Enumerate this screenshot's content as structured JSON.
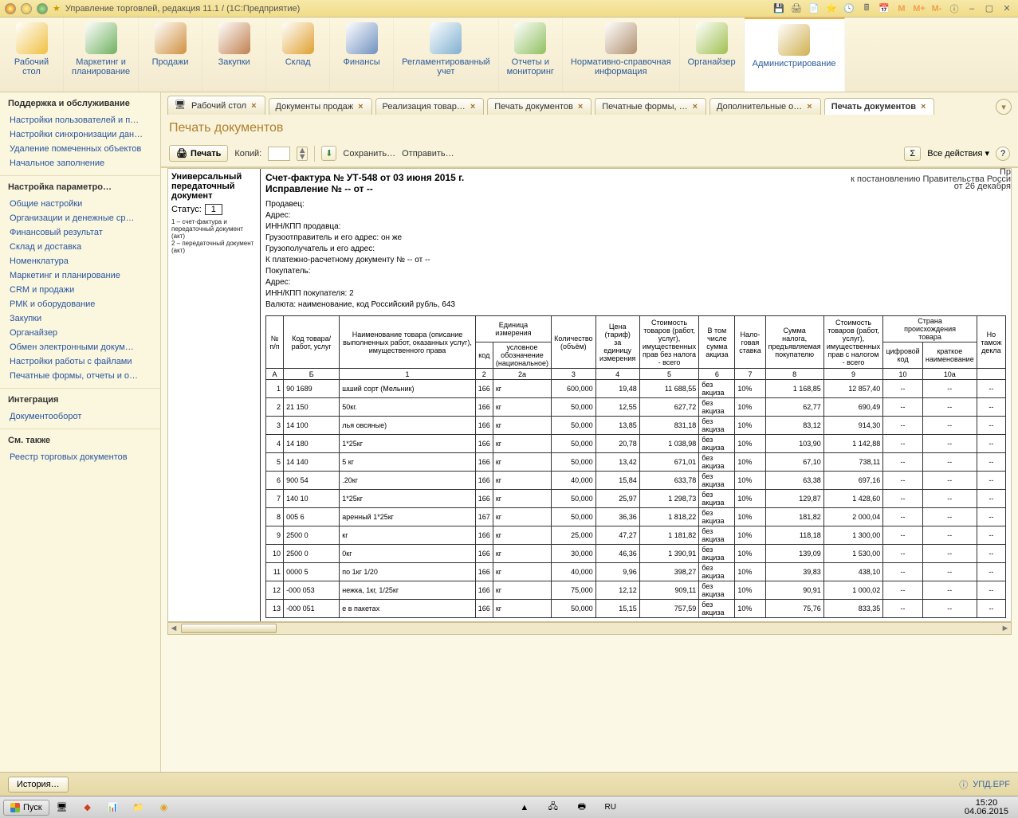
{
  "title_bar": {
    "app_title": "Управление торговлей, редакция 11.1 /          (1С:Предприятие)"
  },
  "ribbon": [
    {
      "label": "Рабочий\nстол",
      "color": "#f0c040"
    },
    {
      "label": "Маркетинг и\nпланирование",
      "color": "#70b060"
    },
    {
      "label": "Продажи",
      "color": "#d09040"
    },
    {
      "label": "Закупки",
      "color": "#c08050"
    },
    {
      "label": "Склад",
      "color": "#e0a030"
    },
    {
      "label": "Финансы",
      "color": "#7090c0"
    },
    {
      "label": "Регламентированный\nучет",
      "color": "#80b0d0"
    },
    {
      "label": "Отчеты и\nмониторинг",
      "color": "#90c060"
    },
    {
      "label": "Нормативно-справочная\nинформация",
      "color": "#b09070"
    },
    {
      "label": "Органайзер",
      "color": "#a0c050"
    },
    {
      "label": "Администрирование",
      "color": "#d0b050",
      "active": true
    }
  ],
  "nav": {
    "sections": [
      {
        "head": "Поддержка и обслуживание",
        "links": [
          "Настройки пользователей и п…",
          "Настройки синхронизации дан…",
          "Удаление помеченных объектов"
        ]
      },
      {
        "head": "",
        "links": [
          "Начальное заполнение"
        ]
      },
      {
        "head": "Настройка параметро…",
        "links": [
          "Общие настройки",
          "Организации и денежные ср…",
          "Финансовый результат",
          "Склад и доставка",
          "Номенклатура",
          "Маркетинг и планирование",
          "CRM и продажи",
          "РМК и оборудование",
          "Закупки",
          "Органайзер",
          "Обмен электронными докум…",
          "Настройки работы с файлами",
          "Печатные формы, отчеты и о…"
        ]
      },
      {
        "head": "Интеграция",
        "links": [
          "Документооборот"
        ]
      },
      {
        "head": "См. также",
        "links": [
          "Реестр торговых документов"
        ]
      }
    ]
  },
  "tabs": [
    {
      "label": "Рабочий стол",
      "icon": true
    },
    {
      "label": "Документы продаж"
    },
    {
      "label": "Реализация товар…"
    },
    {
      "label": "Печать документов"
    },
    {
      "label": "Печатные формы, …"
    },
    {
      "label": "Дополнительные о…"
    },
    {
      "label": "Печать документов",
      "active": true
    }
  ],
  "page_title": "Печать документов",
  "toolbar": {
    "print": "Печать",
    "copies_label": "Копий:",
    "copies_value": "",
    "save": "Сохранить…",
    "send": "Отправить…",
    "all_actions": "Все действия"
  },
  "upd_box": {
    "title_l1": "Универсальный",
    "title_l2": "передаточный",
    "title_l3": "документ",
    "status_label": "Статус:",
    "status_value": "1",
    "note": "1 – счет-фактура и передаточный документ (акт)\n2 – передаточный документ (акт)"
  },
  "doc_header": {
    "title": "Счет-фактура № УТ-548 от 03 июня 2015 г.",
    "subtitle": "Исправление № -- от --",
    "reg1": "Пр",
    "reg2": "к постановлению Правительства Росси",
    "reg3": "от 26 декабря",
    "fields": [
      "Продавец: ",
      "Адрес: ",
      "ИНН/КПП продавца:",
      "Грузоотправитель и его адрес: он же",
      "Грузополучатель и его адрес:",
      "К платежно-расчетному документу № -- от --",
      "Покупатель:",
      "Адрес: ",
      "ИНН/КПП покупателя: 2",
      "Валюта: наименование, код Российский рубль, 643"
    ]
  },
  "table": {
    "headers": {
      "no": "№\nп/п",
      "code": "Код товара/\nработ, услуг",
      "name": "Наименование товара (описание выполненных работ, оказанных услуг), имущественного права",
      "unit": "Единица\nизмерения",
      "unit_code": "код",
      "unit_name": "условное обозначение (национальное)",
      "qty": "Количество\n(объём)",
      "price": "Цена\n(тариф)\nза\nединицу\nизмерения",
      "cost_no_tax": "Стоимость товаров (работ, услуг), имущественных прав без налога - всего",
      "excise": "В том\nчисле\nсумма\nакциза",
      "tax_rate": "Нало-\nговая\nставка",
      "tax_sum": "Сумма\nналога,\nпредъявляемая\nпокупателю",
      "cost_with_tax": "Стоимость товаров (работ, услуг), имущественных прав с налогом - всего",
      "country": "Страна\nпроисхождения\nтовара",
      "country_code": "цифровой\nкод",
      "country_name": "краткое\nнаименование",
      "customs": "Но\nтамож\nдекла"
    },
    "colnums": [
      "А",
      "Б",
      "1",
      "2",
      "2а",
      "3",
      "4",
      "5",
      "6",
      "7",
      "8",
      "9",
      "10",
      "10а",
      ""
    ],
    "rows": [
      {
        "n": "1",
        "code": "90   1689",
        "name": "                   шший сорт (Мельник)",
        "uc": "166",
        "un": "кг",
        "qty": "600,000",
        "price": "19,48",
        "cost": "11 688,55",
        "exc": "без акциза",
        "rate": "10%",
        "tax": "1 168,85",
        "total": "12 857,40",
        "cc": "--",
        "cn": "--",
        "cd": "--"
      },
      {
        "n": "2",
        "code": "21   150",
        "name": "                  50кг.",
        "uc": "166",
        "un": "кг",
        "qty": "50,000",
        "price": "12,55",
        "cost": "627,72",
        "exc": "без акциза",
        "rate": "10%",
        "tax": "62,77",
        "total": "690,49",
        "cc": "--",
        "cn": "--",
        "cd": "--"
      },
      {
        "n": "3",
        "code": "14   100",
        "name": "               лья овсяные)",
        "uc": "166",
        "un": "кг",
        "qty": "50,000",
        "price": "13,85",
        "cost": "831,18",
        "exc": "без акциза",
        "rate": "10%",
        "tax": "83,12",
        "total": "914,30",
        "cc": "--",
        "cn": "--",
        "cd": "--"
      },
      {
        "n": "4",
        "code": "14   180",
        "name": "               1*25кг",
        "uc": "166",
        "un": "кг",
        "qty": "50,000",
        "price": "20,78",
        "cost": "1 038,98",
        "exc": "без акциза",
        "rate": "10%",
        "tax": "103,90",
        "total": "1 142,88",
        "cc": "--",
        "cn": "--",
        "cd": "--"
      },
      {
        "n": "5",
        "code": "14   140",
        "name": "               5 кг",
        "uc": "166",
        "un": "кг",
        "qty": "50,000",
        "price": "13,42",
        "cost": "671,01",
        "exc": "без акциза",
        "rate": "10%",
        "tax": "67,10",
        "total": "738,11",
        "cc": "--",
        "cn": "--",
        "cd": "--"
      },
      {
        "n": "6",
        "code": "900  54",
        "name": "               .20кг",
        "uc": "166",
        "un": "кг",
        "qty": "40,000",
        "price": "15,84",
        "cost": "633,78",
        "exc": "без акциза",
        "rate": "10%",
        "tax": "63,38",
        "total": "697,16",
        "cc": "--",
        "cn": "--",
        "cd": "--"
      },
      {
        "n": "7",
        "code": "140  10",
        "name": "               1*25кг",
        "uc": "166",
        "un": "кг",
        "qty": "50,000",
        "price": "25,97",
        "cost": "1 298,73",
        "exc": "без акциза",
        "rate": "10%",
        "tax": "129,87",
        "total": "1 428,60",
        "cc": "--",
        "cn": "--",
        "cd": "--"
      },
      {
        "n": "8",
        "code": "005  6",
        "name": "               аренный 1*25кг",
        "uc": "167",
        "un": "кг",
        "qty": "50,000",
        "price": "36,36",
        "cost": "1 818,22",
        "exc": "без акциза",
        "rate": "10%",
        "tax": "181,82",
        "total": "2 000,04",
        "cc": "--",
        "cn": "--",
        "cd": "--"
      },
      {
        "n": "9",
        "code": "2500  0",
        "name": "               кг",
        "uc": "166",
        "un": "кг",
        "qty": "25,000",
        "price": "47,27",
        "cost": "1 181,82",
        "exc": "без акциза",
        "rate": "10%",
        "tax": "118,18",
        "total": "1 300,00",
        "cc": "--",
        "cn": "--",
        "cd": "--"
      },
      {
        "n": "10",
        "code": "2500  0",
        "name": "               0кг",
        "uc": "166",
        "un": "кг",
        "qty": "30,000",
        "price": "46,36",
        "cost": "1 390,91",
        "exc": "без акциза",
        "rate": "10%",
        "tax": "139,09",
        "total": "1 530,00",
        "cc": "--",
        "cn": "--",
        "cd": "--"
      },
      {
        "n": "11",
        "code": "0000  5",
        "name": "               по 1кг 1/20",
        "uc": "166",
        "un": "кг",
        "qty": "40,000",
        "price": "9,96",
        "cost": "398,27",
        "exc": "без акциза",
        "rate": "10%",
        "tax": "39,83",
        "total": "438,10",
        "cc": "--",
        "cn": "--",
        "cd": "--"
      },
      {
        "n": "12",
        "code": "-000  053",
        "name": "               нежка, 1кг, 1/25кг",
        "uc": "166",
        "un": "кг",
        "qty": "75,000",
        "price": "12,12",
        "cost": "909,11",
        "exc": "без акциза",
        "rate": "10%",
        "tax": "90,91",
        "total": "1 000,02",
        "cc": "--",
        "cn": "--",
        "cd": "--"
      },
      {
        "n": "13",
        "code": "-000  051",
        "name": "               е в пакетах",
        "uc": "166",
        "un": "кг",
        "qty": "50,000",
        "price": "15,15",
        "cost": "757,59",
        "exc": "без акциза",
        "rate": "10%",
        "tax": "75,76",
        "total": "833,35",
        "cc": "--",
        "cn": "--",
        "cd": "--"
      }
    ]
  },
  "status_bar": {
    "history": "История…",
    "file": "УПД.EPF"
  },
  "taskbar": {
    "start": "Пуск",
    "time": "15:20",
    "date": "04.06.2015"
  }
}
